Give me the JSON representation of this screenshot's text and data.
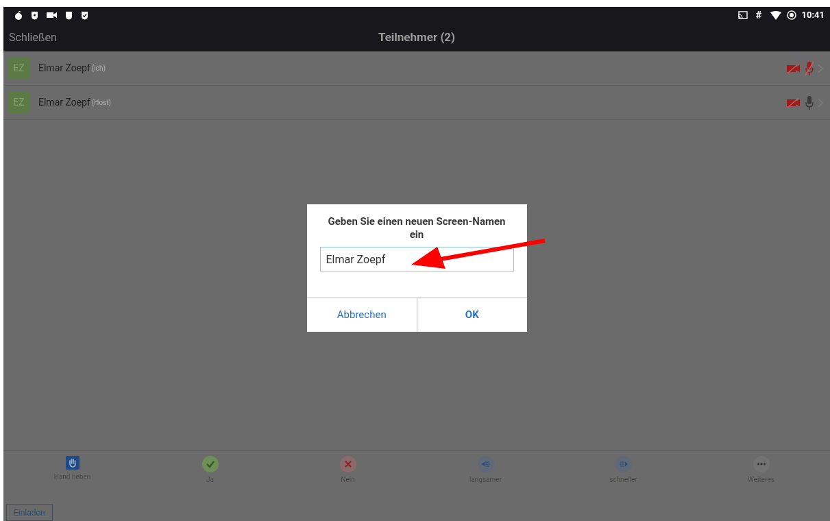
{
  "status_bar": {
    "time": "10:41",
    "hash": "#"
  },
  "header": {
    "close": "Schließen",
    "title": "Teilnehmer (2)"
  },
  "participants": [
    {
      "initials": "EZ",
      "name": "Elmar Zoepf",
      "tag": "(ich)",
      "video_muted": true,
      "audio_muted": true
    },
    {
      "initials": "EZ",
      "name": "Elmar Zoepf",
      "tag": "(Host)",
      "video_muted": true,
      "audio_muted": false
    }
  ],
  "dialog": {
    "title": "Geben Sie einen neuen Screen-Namen ein",
    "value": "Elmar Zoepf",
    "buttons": [
      {
        "label": "Abbrechen",
        "bold": false
      },
      {
        "label": "OK",
        "bold": true
      }
    ]
  },
  "toolbar": [
    {
      "kind": "hand",
      "label": "Hand heben"
    },
    {
      "kind": "yes",
      "label": "Ja"
    },
    {
      "kind": "no",
      "label": "Nein"
    },
    {
      "kind": "slower",
      "label": "langsamer"
    },
    {
      "kind": "faster",
      "label": "schneller"
    },
    {
      "kind": "more",
      "label": "Weiteres"
    }
  ],
  "invite": "Einladen"
}
